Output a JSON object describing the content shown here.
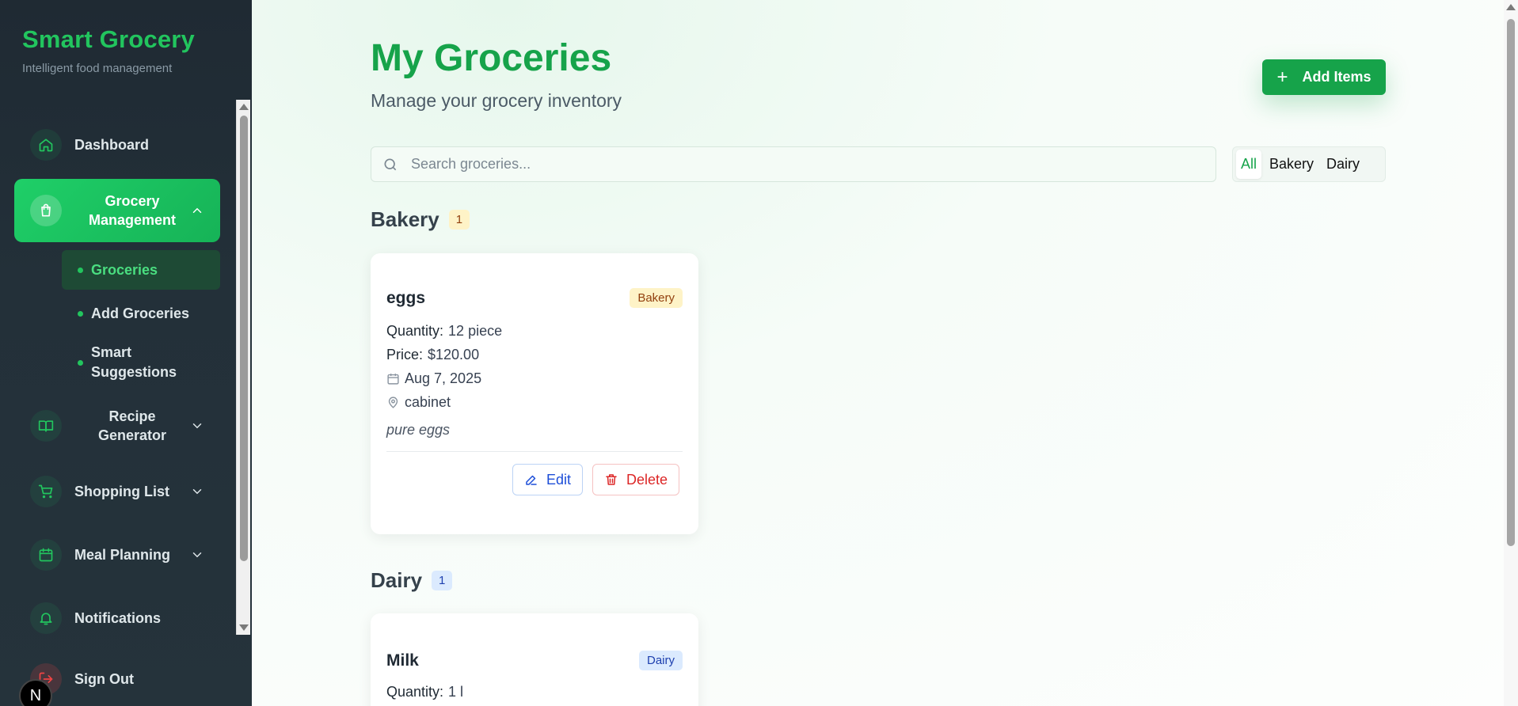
{
  "brand": {
    "title": "Smart Grocery",
    "subtitle": "Intelligent food management"
  },
  "nav": {
    "dashboard": "Dashboard",
    "grocery_management": "Grocery Management",
    "sub": {
      "groceries": "Groceries",
      "add_groceries": "Add Groceries",
      "smart_suggestions": "Smart Suggestions"
    },
    "recipe_generator": "Recipe Generator",
    "shopping_list": "Shopping List",
    "meal_planning": "Meal Planning",
    "notifications": "Notifications",
    "sign_out": "Sign Out"
  },
  "badge": "N",
  "header": {
    "title": "My Groceries",
    "subtitle": "Manage your grocery inventory",
    "add_button": "Add Items"
  },
  "search": {
    "placeholder": "Search groceries..."
  },
  "filters": [
    "All",
    "Bakery",
    "Dairy"
  ],
  "colors": {
    "accent": "#16a34a",
    "sidebar": "#1f2a33"
  },
  "sections": [
    {
      "name": "Bakery",
      "count": "1",
      "items": [
        {
          "name": "eggs",
          "category": "Bakery",
          "quantity_label": "Quantity:",
          "quantity": "12 piece",
          "price_label": "Price:",
          "price": "$120.00",
          "date": "Aug 7, 2025",
          "location": "cabinet",
          "notes": "pure eggs",
          "edit": "Edit",
          "delete": "Delete"
        }
      ]
    },
    {
      "name": "Dairy",
      "count": "1",
      "items": [
        {
          "name": "Milk",
          "category": "Dairy",
          "quantity_label": "Quantity:",
          "quantity": "1 l"
        }
      ]
    }
  ]
}
